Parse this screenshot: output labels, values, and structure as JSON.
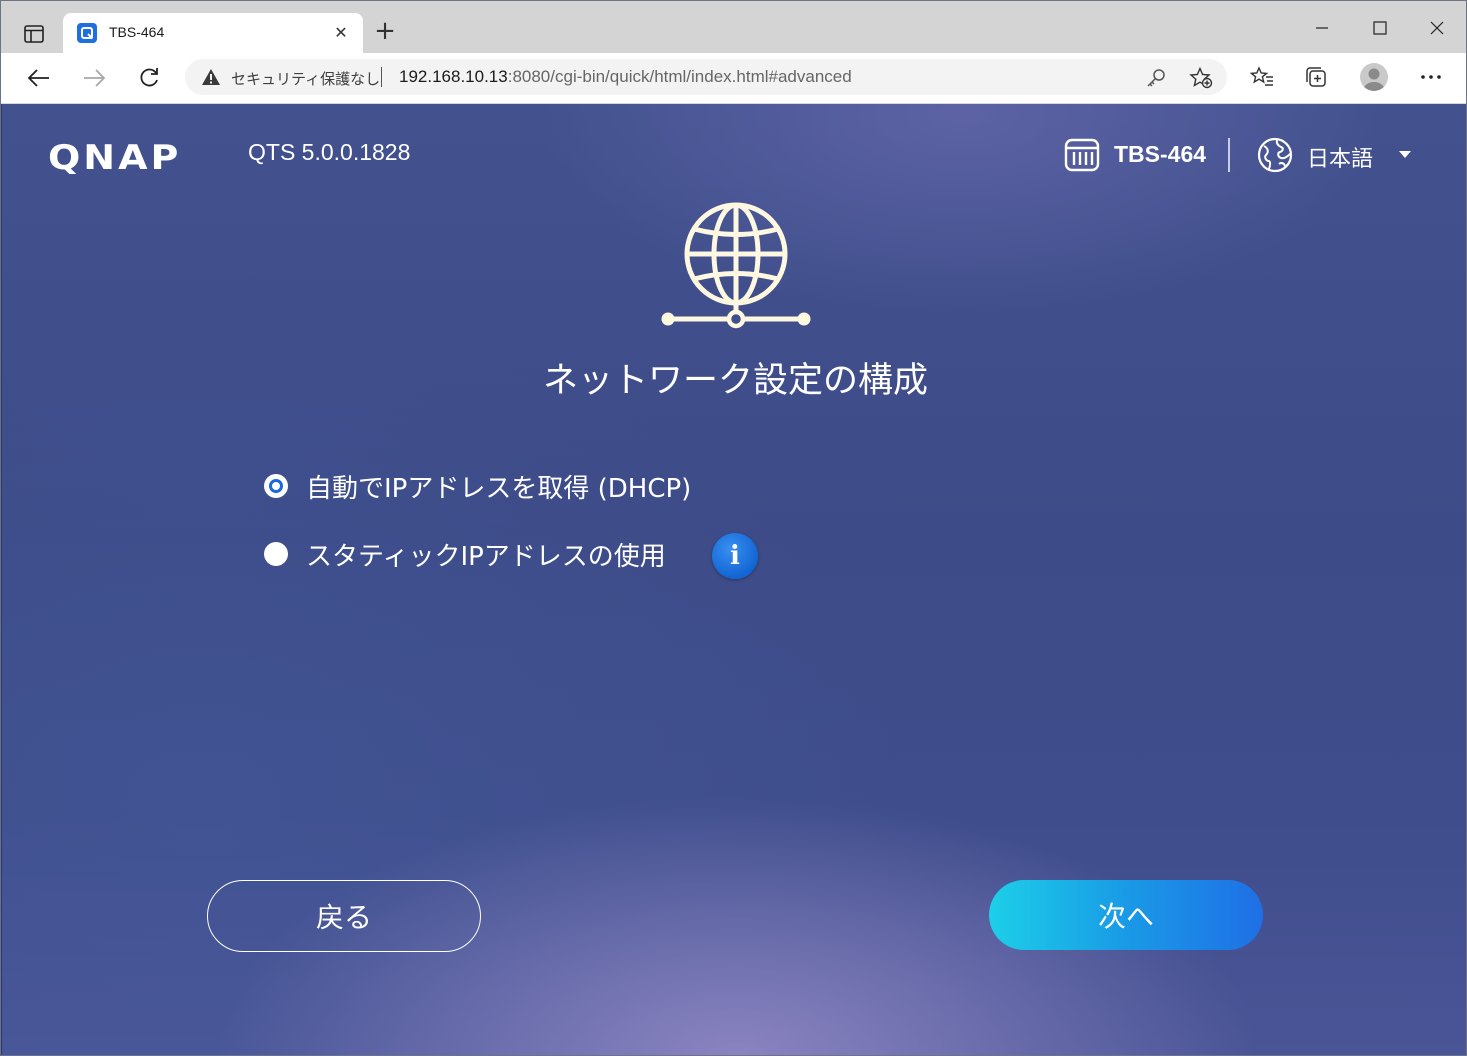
{
  "browser": {
    "tab": {
      "title": "TBS-464",
      "favicon": "qnap-favicon-icon"
    },
    "address_bar": {
      "security_label": "セキュリティ保護なし",
      "url_host": "192.168.10.13",
      "url_rest": ":8080/cgi-bin/quick/html/index.html#advanced"
    }
  },
  "header": {
    "logo": "QNAP",
    "version": "QTS 5.0.0.1828",
    "device_name": "TBS-464",
    "language": "日本語"
  },
  "main": {
    "title": "ネットワーク設定の構成",
    "options": [
      {
        "label": "自動でIPアドレスを取得 (DHCP)",
        "selected": true
      },
      {
        "label": "スタティックIPアドレスの使用",
        "selected": false
      }
    ],
    "info_icon_glyph": "i"
  },
  "footer": {
    "back_label": "戻る",
    "next_label": "次へ"
  },
  "colors": {
    "page_bg": "#3f4d8c",
    "radio_selected": "#1a67e0",
    "next_gradient_start": "#1ccfe8",
    "next_gradient_end": "#1f6fe6",
    "globe_icon": "#fff8e0"
  }
}
